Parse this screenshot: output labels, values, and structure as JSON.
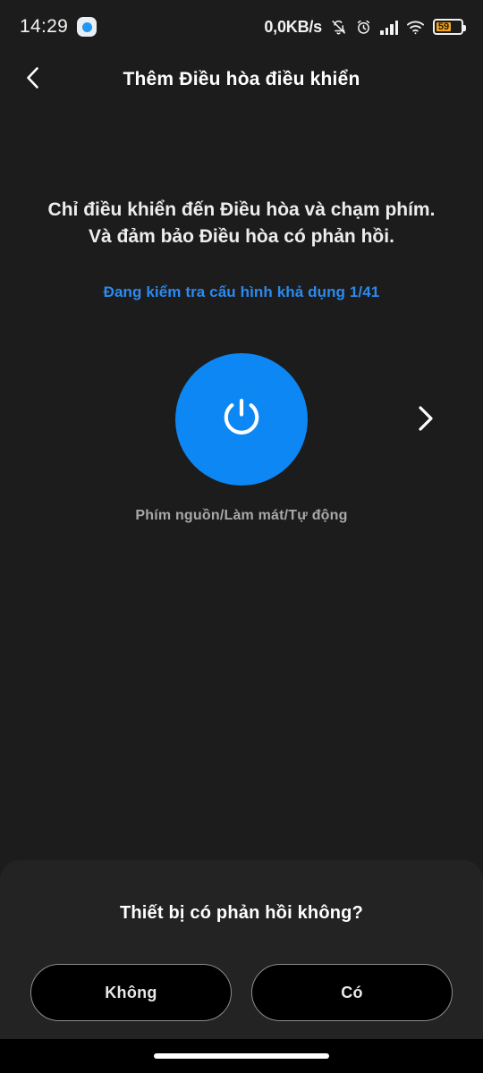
{
  "status_bar": {
    "time": "14:29",
    "app_badge_icon": "messenger-badge-icon",
    "network_speed": "0,0KB/s",
    "icons": [
      "bell-muted-icon",
      "alarm-clock-icon",
      "signal-bars-icon",
      "wifi-icon"
    ],
    "battery_percent": "59"
  },
  "app_bar": {
    "back_icon": "chevron-left-icon",
    "title": "Thêm Điều hòa điều khiển"
  },
  "main": {
    "instruction_line_1": "Chỉ điều khiển đến Điều hòa và chạm phím.",
    "instruction_line_2": "Và đảm bảo Điều hòa có phản hồi.",
    "progress_text": "Đang kiểm tra cấu hình khả dụng 1/41",
    "power_button_icon": "power-icon",
    "power_button_caption": "Phím nguồn/Làm mát/Tự động",
    "next_icon": "chevron-right-icon"
  },
  "bottom_sheet": {
    "question": "Thiết bị có phản hồi không?",
    "negative_label": "Không",
    "positive_label": "Có"
  },
  "nav_bar": {
    "home_indicator": "home-indicator"
  },
  "colors": {
    "background": "#1c1c1c",
    "sheet": "#232323",
    "accent_blue": "#0d87f3",
    "progress_blue": "#2a8af0",
    "battery_amber": "#f0a323",
    "text_primary": "#ffffff",
    "text_muted": "#a8a8a8"
  }
}
